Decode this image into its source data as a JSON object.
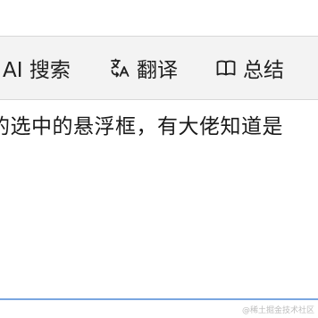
{
  "toolbar": {
    "search": {
      "label": "AI 搜索",
      "icon": "none"
    },
    "translate": {
      "label": "翻译",
      "icon": "translate-icon"
    },
    "summary": {
      "label": "总结",
      "icon": "book-icon"
    }
  },
  "content": {
    "text": "的选中的悬浮框，有大佬知道是"
  },
  "watermark": "@稀土掘金技术社区",
  "colors": {
    "toolbar_bg": "#f3f3f3",
    "border": "#d8d8d8",
    "bottom_border": "#7aa7e0",
    "text": "#1f1f1f"
  }
}
